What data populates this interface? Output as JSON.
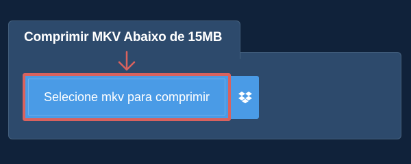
{
  "converter": {
    "title": "Comprimir MKV Abaixo de 15MB",
    "select_button_label": "Selecione mkv para comprimir",
    "dropbox_icon": "dropbox-icon",
    "arrow_icon": "arrow-down-icon"
  },
  "colors": {
    "background": "#10223a",
    "panel": "#2d4a6c",
    "button": "#4a9be6",
    "highlight": "#d9625e"
  }
}
